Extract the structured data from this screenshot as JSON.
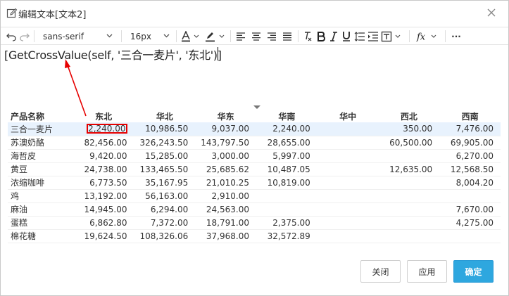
{
  "window": {
    "title": "编辑文本[文本2]"
  },
  "toolbar": {
    "font_family": "sans-serif",
    "font_size": "16px",
    "more": "···"
  },
  "editor": {
    "content": "[GetCrossValue(self, '三合一麦片', '东北')]"
  },
  "table": {
    "columns": [
      "产品名称",
      "东北",
      "华北",
      "华东",
      "华南",
      "华中",
      "西北",
      "西南"
    ],
    "rows": [
      [
        "三合一麦片",
        "2,240.00",
        "10,986.50",
        "9,037.00",
        "2,240.00",
        "",
        "350.00",
        "7,476.00"
      ],
      [
        "苏澳奶酪",
        "82,456.00",
        "326,243.50",
        "143,797.50",
        "28,655.00",
        "",
        "60,500.00",
        "69,905.00"
      ],
      [
        "海哲皮",
        "9,420.00",
        "15,285.00",
        "3,000.00",
        "5,997.00",
        "",
        "",
        "6,270.00"
      ],
      [
        "黄豆",
        "24,738.00",
        "133,465.50",
        "25,685.62",
        "10,487.05",
        "",
        "12,635.00",
        "12,568.50"
      ],
      [
        "浓缩咖啡",
        "6,773.50",
        "35,167.95",
        "21,010.25",
        "10,819.00",
        "",
        "",
        "8,004.20"
      ],
      [
        "鸡",
        "13,192.00",
        "56,163.00",
        "2,910.00",
        "",
        "",
        "",
        ""
      ],
      [
        "麻油",
        "14,945.00",
        "6,294.00",
        "24,563.00",
        "",
        "",
        "",
        "7,670.00"
      ],
      [
        "蛋糕",
        "6,862.80",
        "7,372.00",
        "18,791.00",
        "2,375.00",
        "",
        "",
        "4,275.00"
      ],
      [
        "棉花糖",
        "19,624.50",
        "108,326.06",
        "37,968.00",
        "32,572.89",
        "",
        "",
        ""
      ]
    ]
  },
  "footer": {
    "close_label": "关闭",
    "apply_label": "应用",
    "ok_label": "确定"
  },
  "colors": {
    "accent": "#2ea7df",
    "highlight": "#e60000",
    "selected_row": "#e8f2fd"
  }
}
